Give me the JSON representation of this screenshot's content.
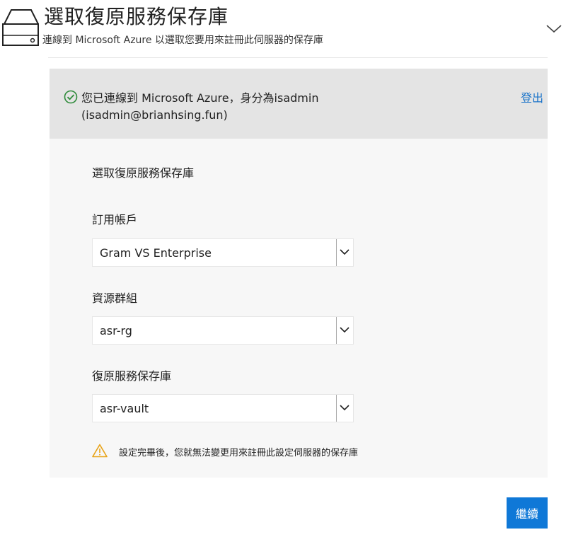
{
  "header": {
    "title": "選取復原服務保存庫",
    "subtitle": "連線到 Microsoft Azure 以選取您要用來註冊此伺服器的保存庫"
  },
  "connection": {
    "status_line1": "您已連線到 Microsoft Azure，身分為isadmin",
    "status_line2": "(isadmin@brianhsing.fun)",
    "signout_label": "登出"
  },
  "form": {
    "section_title": "選取復原服務保存庫",
    "subscription": {
      "label": "訂用帳戶",
      "selected": "Gram VS Enterprise"
    },
    "resource_group": {
      "label": "資源群組",
      "selected": "asr-rg"
    },
    "vault": {
      "label": "復原服務保存庫",
      "selected": "asr-vault"
    },
    "warning": "設定完畢後，您就無法變更用來註冊此設定伺服器的保存庫"
  },
  "footer": {
    "continue_label": "繼續"
  },
  "colors": {
    "accent": "#0f78d7",
    "link": "#1a73c9",
    "success": "#2e8b3a",
    "warning": "#e8a317",
    "banner": "#e4e4e4",
    "panel": "#f7f7f7"
  }
}
